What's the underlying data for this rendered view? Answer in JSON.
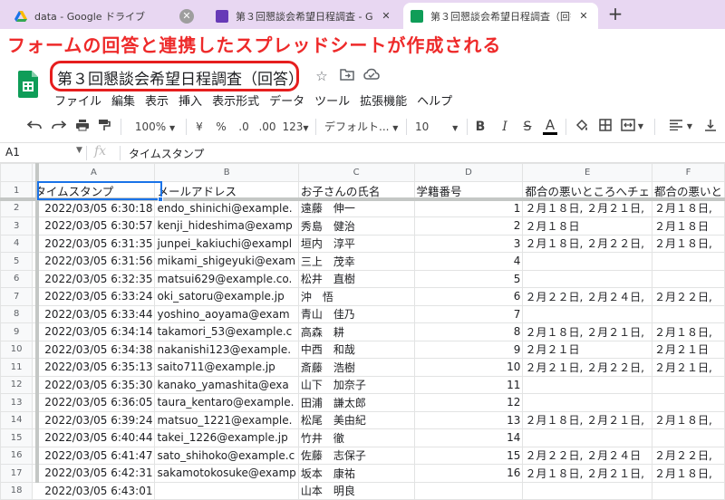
{
  "browser": {
    "tabs": [
      {
        "title": "data - Google ドライブ",
        "close": "✕"
      },
      {
        "title": "第３回懇談会希望日程調査 - Goo",
        "close": "✕"
      },
      {
        "title": "第３回懇談会希望日程調査（回答）",
        "close": "✕"
      }
    ],
    "new_tab": "+"
  },
  "annotation": {
    "text": "フォームの回答と連携したスプレッドシートが作成される",
    "color": "#ee2a2a"
  },
  "doc": {
    "title": "第３回懇談会希望日程調査（回答）"
  },
  "menu": [
    "ファイル",
    "編集",
    "表示",
    "挿入",
    "表示形式",
    "データ",
    "ツール",
    "拡張機能",
    "ヘルプ"
  ],
  "toolbar": {
    "zoom": "100%",
    "currency": "¥",
    "percent": "%",
    "dec_decrease": ".0",
    "dec_increase": ".00",
    "format_more": "123",
    "font": "デフォルト...",
    "font_size": "10",
    "bold": "B",
    "italic": "I",
    "strike": "S",
    "text_color": "A"
  },
  "formula_bar": {
    "cell": "A1",
    "fx": "fx",
    "content": "タイムスタンプ"
  },
  "sheet": {
    "columns": [
      "A",
      "B",
      "C",
      "D",
      "E",
      "F"
    ],
    "headers": [
      "タイムスタンプ",
      "メールアドレス",
      "お子さんの氏名",
      "学籍番号",
      "都合の悪いところへチェ",
      "都合の悪いと"
    ],
    "rows": [
      [
        "2",
        "2022/03/05 6:30:18",
        "endo_shinichi@example.",
        "遠藤　伸一",
        "1",
        "２月１８日, ２月２１日,",
        "２月１８日,"
      ],
      [
        "3",
        "2022/03/05 6:30:57",
        "kenji_hideshima@examp",
        "秀島　健治",
        "2",
        "２月１８日",
        "２月１８日"
      ],
      [
        "4",
        "2022/03/05 6:31:35",
        "junpei_kakiuchi@exampl",
        "垣内　淳平",
        "3",
        "２月１８日, ２月２２日,",
        "２月１８日,"
      ],
      [
        "5",
        "2022/03/05 6:31:56",
        "mikami_shigeyuki@exam",
        "三上　茂幸",
        "4",
        "",
        ""
      ],
      [
        "6",
        "2022/03/05 6:32:35",
        "matsui629@example.co.",
        "松井　直樹",
        "5",
        "",
        ""
      ],
      [
        "7",
        "2022/03/05 6:33:24",
        "oki_satoru@example.jp",
        "沖　悟",
        "6",
        "２月２２日, ２月２４日,",
        "２月２２日,"
      ],
      [
        "8",
        "2022/03/05 6:33:44",
        "yoshino_aoyama@exam",
        "青山　佳乃",
        "7",
        "",
        ""
      ],
      [
        "9",
        "2022/03/05 6:34:14",
        "takamori_53@example.c",
        "高森　耕",
        "8",
        "２月１８日, ２月２１日,",
        "２月１８日,"
      ],
      [
        "10",
        "2022/03/05 6:34:38",
        "nakanishi123@example.",
        "中西　和哉",
        "9",
        "２月２１日",
        "２月２１日"
      ],
      [
        "11",
        "2022/03/05 6:35:13",
        "saito711@example.jp",
        "斎藤　浩樹",
        "10",
        "２月２１日, ２月２２日,",
        "２月２１日,"
      ],
      [
        "12",
        "2022/03/05 6:35:30",
        "kanako_yamashita@exa",
        "山下　加奈子",
        "11",
        "",
        ""
      ],
      [
        "13",
        "2022/03/05 6:36:05",
        "taura_kentaro@example.",
        "田浦　謙太郎",
        "12",
        "",
        ""
      ],
      [
        "14",
        "2022/03/05 6:39:24",
        "matsuo_1221@example.",
        "松尾　美由紀",
        "13",
        "２月１８日, ２月２１日,",
        "２月１８日,"
      ],
      [
        "15",
        "2022/03/05 6:40:44",
        "takei_1226@example.jp",
        "竹井　徹",
        "14",
        "",
        ""
      ],
      [
        "16",
        "2022/03/05 6:41:47",
        "sato_shihoko@example.c",
        "佐藤　志保子",
        "15",
        "２月２２日, ２月２４日",
        "２月２２日,"
      ],
      [
        "17",
        "2022/03/05 6:42:31",
        "sakamotokosuke@examp",
        "坂本　康祐",
        "16",
        "２月１８日, ２月２１日,",
        "２月１８日,"
      ],
      [
        "18",
        "2022/03/05 6:43:01",
        "",
        "山本　明良",
        "",
        "",
        ""
      ]
    ]
  }
}
